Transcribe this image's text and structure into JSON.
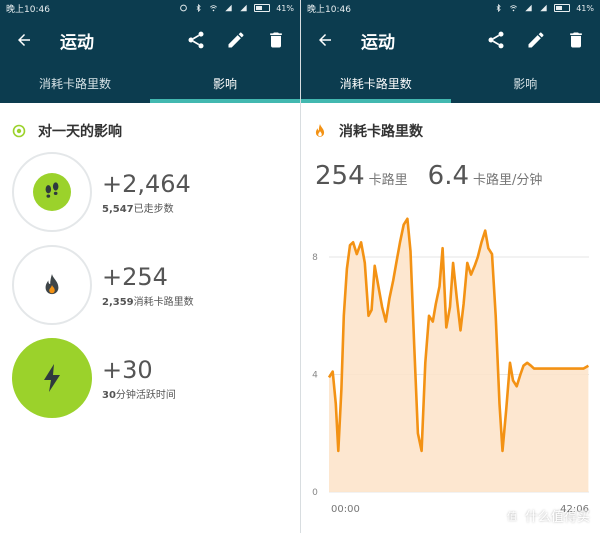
{
  "status": {
    "time": "晚上10:46",
    "battery": "41%"
  },
  "appbar": {
    "title": "运动"
  },
  "tabs": [
    {
      "label": "消耗卡路里数"
    },
    {
      "label": "影响"
    }
  ],
  "left": {
    "section_title": "对一天的影响",
    "impacts": [
      {
        "value": "+2,464",
        "sub_bold": "5,547",
        "sub_text": "已走步数"
      },
      {
        "value": "+254",
        "sub_bold": "2,359",
        "sub_text": "消耗卡路里数"
      },
      {
        "value": "+30",
        "sub_bold": "30",
        "sub_text": "分钟活跃时间"
      }
    ]
  },
  "right": {
    "section_title": "消耗卡路里数",
    "stat1": {
      "value": "254",
      "unit": "卡路里"
    },
    "stat2": {
      "value": "6.4",
      "unit": "卡路里/分钟"
    }
  },
  "watermark": {
    "text": "什么值得买",
    "mark": "值"
  },
  "colors": {
    "header": "#0c3c4f",
    "tab_indicator": "#42b8b0",
    "accent_green": "#9bd22b",
    "chart_line": "#f39214",
    "chart_fill": "#fde3c8"
  },
  "chart_data": {
    "type": "area",
    "xlabel": "",
    "ylabel": "",
    "x_tick_labels": [
      "00:00",
      "42:06"
    ],
    "xlim": [
      0,
      42.1
    ],
    "ylim": [
      0,
      9.6
    ],
    "y_ticks": [
      0,
      4,
      8
    ],
    "grid": true,
    "series": [
      {
        "x": [
          0,
          0.6,
          1.1,
          1.5,
          2.0,
          2.4,
          2.9,
          3.4,
          3.9,
          4.5,
          5.2,
          5.8,
          6.4,
          6.9,
          7.4,
          8.0,
          8.6,
          9.2,
          9.8,
          10.4,
          10.9,
          11.5,
          12.1,
          12.7,
          13.2,
          13.8,
          14.4,
          15.0,
          15.6,
          16.2,
          16.8,
          17.3,
          17.9,
          18.4,
          19.0,
          19.6,
          20.1,
          20.7,
          21.3,
          21.8,
          22.4,
          23.0,
          23.6,
          24.1,
          24.7,
          25.3,
          25.8,
          26.4,
          27.0,
          27.6,
          28.1,
          28.7,
          29.3,
          29.8,
          30.4,
          31.0,
          31.5,
          32.1,
          32.7,
          33.2,
          33.8,
          34.4,
          35.0,
          35.5,
          36.1,
          36.7,
          37.2,
          37.8,
          38.4,
          39.0,
          39.5,
          40.1,
          40.6,
          41.2,
          42.0
        ],
        "y": [
          3.9,
          4.1,
          3.0,
          1.4,
          3.5,
          6.0,
          7.6,
          8.4,
          8.5,
          8.1,
          8.5,
          7.8,
          6.0,
          6.2,
          7.7,
          7.0,
          6.3,
          5.8,
          6.6,
          7.2,
          7.8,
          8.5,
          9.1,
          9.3,
          8.2,
          5.0,
          2.0,
          1.4,
          4.4,
          6.0,
          5.8,
          6.4,
          7.0,
          8.3,
          5.6,
          6.3,
          7.8,
          6.6,
          5.5,
          6.4,
          7.8,
          7.4,
          7.7,
          8.0,
          8.5,
          8.9,
          8.3,
          8.1,
          6.0,
          3.0,
          1.4,
          2.8,
          4.4,
          3.8,
          3.6,
          4.0,
          4.3,
          4.4,
          4.3,
          4.2,
          4.2,
          4.2,
          4.2,
          4.2,
          4.2,
          4.2,
          4.2,
          4.2,
          4.2,
          4.2,
          4.2,
          4.2,
          4.2,
          4.2,
          4.3
        ]
      }
    ]
  }
}
